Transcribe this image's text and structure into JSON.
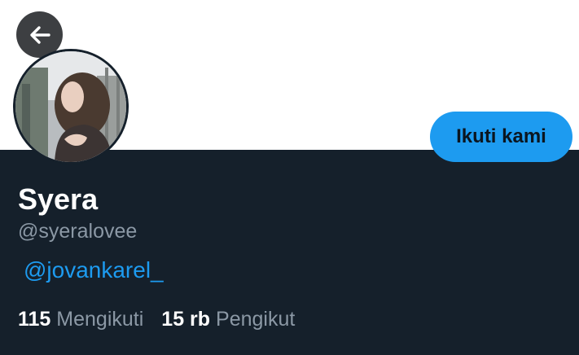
{
  "header": {
    "back_icon": "arrow-left-icon"
  },
  "profile": {
    "avatar": "avatar-photo",
    "display_name": "Syera",
    "handle": "@syeralovee",
    "bio_link": "@jovankarel_",
    "follow_label": "Ikuti kami",
    "stats": {
      "following_count": "115",
      "following_label": "Mengikuti",
      "followers_count": "15 rb",
      "followers_label": "Pengikut"
    }
  },
  "colors": {
    "panel_bg": "#15202b",
    "accent": "#1d9bf0",
    "muted_text": "#8b98a5"
  }
}
